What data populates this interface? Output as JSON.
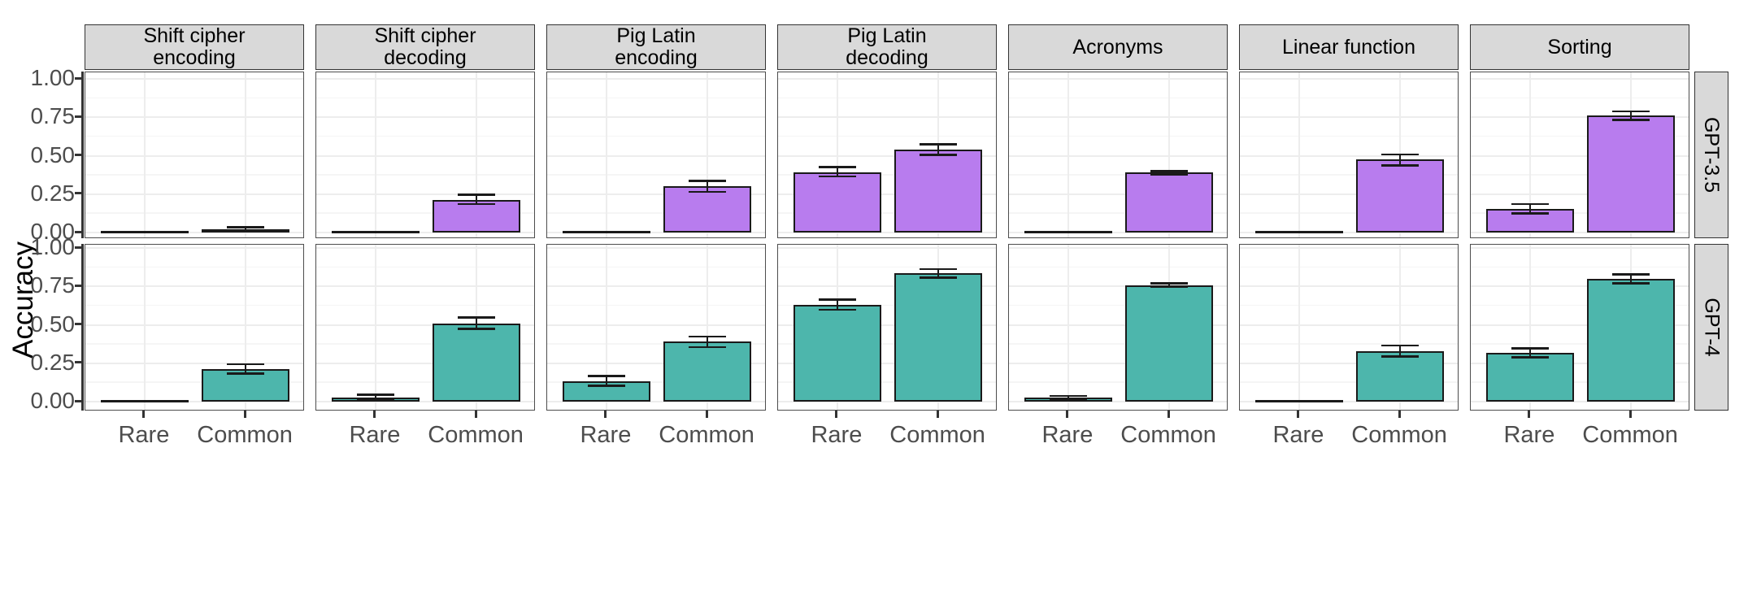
{
  "axis": {
    "y_title": "Accuracy",
    "y_ticks": [
      "0.00",
      "0.25",
      "0.50",
      "0.75",
      "1.00"
    ],
    "x_ticks": [
      "Rare",
      "Common"
    ]
  },
  "row_strips": [
    "GPT-3.5",
    "GPT-4"
  ],
  "colors": {
    "gpt35": "#b87cee",
    "gpt4": "#4db6ac",
    "strip_bg": "#d9d9d9",
    "panel_border": "#4d4d4d",
    "gridline": "#ededed",
    "bar_outline": "#1a1a1a"
  },
  "facets": [
    {
      "title_line1": "Shift cipher",
      "title_line2": "encoding"
    },
    {
      "title_line1": "Shift cipher",
      "title_line2": "decoding"
    },
    {
      "title_line1": "Pig Latin",
      "title_line2": "encoding"
    },
    {
      "title_line1": "Pig Latin",
      "title_line2": "decoding"
    },
    {
      "title_line1": "Acronyms",
      "title_line2": ""
    },
    {
      "title_line1": "Linear function",
      "title_line2": ""
    },
    {
      "title_line1": "Sorting",
      "title_line2": ""
    }
  ],
  "chart_data": {
    "type": "bar",
    "title": "",
    "xlabel": "",
    "ylabel": "Accuracy",
    "ylim": [
      0,
      1.0
    ],
    "ytick_values": [
      0.0,
      0.25,
      0.5,
      0.75,
      1.0
    ],
    "grid": true,
    "legend": "none",
    "facet_rows": [
      "GPT-3.5",
      "GPT-4"
    ],
    "facet_cols": [
      "Shift cipher encoding",
      "Shift cipher decoding",
      "Pig Latin encoding",
      "Pig Latin decoding",
      "Acronyms",
      "Linear function",
      "Sorting"
    ],
    "categories": [
      "Rare",
      "Common"
    ],
    "panels": [
      {
        "row": "GPT-3.5",
        "col": "Shift cipher encoding",
        "values": [
          0.0,
          0.02
        ],
        "err_low": [
          0.0,
          0.008
        ],
        "err_high": [
          0.0,
          0.035
        ]
      },
      {
        "row": "GPT-3.5",
        "col": "Shift cipher decoding",
        "values": [
          0.0,
          0.21
        ],
        "err_low": [
          0.0,
          0.185
        ],
        "err_high": [
          0.0,
          0.245
        ]
      },
      {
        "row": "GPT-3.5",
        "col": "Pig Latin encoding",
        "values": [
          0.0,
          0.3
        ],
        "err_low": [
          0.0,
          0.265
        ],
        "err_high": [
          0.0,
          0.335
        ]
      },
      {
        "row": "GPT-3.5",
        "col": "Pig Latin decoding",
        "values": [
          0.39,
          0.54
        ],
        "err_low": [
          0.365,
          0.505
        ],
        "err_high": [
          0.425,
          0.575
        ]
      },
      {
        "row": "GPT-3.5",
        "col": "Acronyms",
        "values": [
          0.0,
          0.39
        ],
        "err_low": [
          0.0,
          0.378
        ],
        "err_high": [
          0.0,
          0.398
        ]
      },
      {
        "row": "GPT-3.5",
        "col": "Linear function",
        "values": [
          0.0,
          0.475
        ],
        "err_low": [
          0.0,
          0.438
        ],
        "err_high": [
          0.0,
          0.508
        ]
      },
      {
        "row": "GPT-3.5",
        "col": "Sorting",
        "values": [
          0.155,
          0.76
        ],
        "err_low": [
          0.125,
          0.733
        ],
        "err_high": [
          0.185,
          0.788
        ]
      },
      {
        "row": "GPT-4",
        "col": "Shift cipher encoding",
        "values": [
          0.0,
          0.21
        ],
        "err_low": [
          0.0,
          0.182
        ],
        "err_high": [
          0.0,
          0.243
        ]
      },
      {
        "row": "GPT-4",
        "col": "Shift cipher decoding",
        "values": [
          0.028,
          0.51
        ],
        "err_low": [
          0.012,
          0.475
        ],
        "err_high": [
          0.045,
          0.548
        ]
      },
      {
        "row": "GPT-4",
        "col": "Pig Latin encoding",
        "values": [
          0.133,
          0.39
        ],
        "err_low": [
          0.105,
          0.355
        ],
        "err_high": [
          0.165,
          0.423
        ]
      },
      {
        "row": "GPT-4",
        "col": "Pig Latin decoding",
        "values": [
          0.632,
          0.835
        ],
        "err_low": [
          0.598,
          0.808
        ],
        "err_high": [
          0.665,
          0.862
        ]
      },
      {
        "row": "GPT-4",
        "col": "Acronyms",
        "values": [
          0.025,
          0.757
        ],
        "err_low": [
          0.015,
          0.748
        ],
        "err_high": [
          0.037,
          0.768
        ]
      },
      {
        "row": "GPT-4",
        "col": "Linear function",
        "values": [
          0.0,
          0.328
        ],
        "err_low": [
          0.0,
          0.292
        ],
        "err_high": [
          0.0,
          0.365
        ]
      },
      {
        "row": "GPT-4",
        "col": "Sorting",
        "values": [
          0.318,
          0.798
        ],
        "err_low": [
          0.288,
          0.768
        ],
        "err_high": [
          0.348,
          0.828
        ]
      }
    ]
  }
}
